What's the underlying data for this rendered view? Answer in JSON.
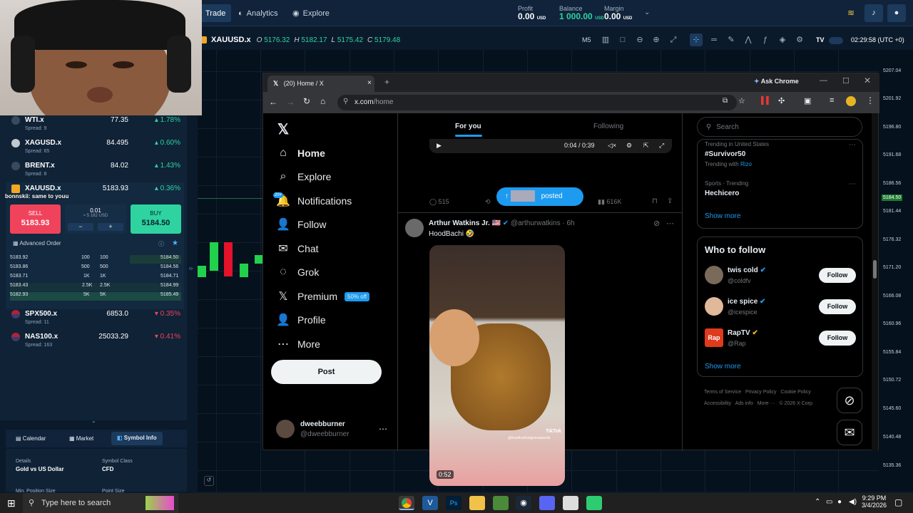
{
  "header": {
    "nav": [
      {
        "label": "Trade"
      },
      {
        "label": "Analytics"
      },
      {
        "label": "Explore"
      }
    ],
    "profit": {
      "label": "Profit",
      "value": "0.00",
      "unit": "USD"
    },
    "balance": {
      "label": "Balance",
      "value": "1 000.00",
      "unit": "USD"
    },
    "margin": {
      "label": "Margin",
      "value": "0.00",
      "unit": "USD"
    }
  },
  "symbar": {
    "symbol": "XAUUSD.x",
    "o": "O",
    "o_val": "5176.32",
    "h": "H",
    "h_val": "5182.17",
    "l": "L",
    "l_val": "5175.42",
    "c": "C",
    "c_val": "5179.48",
    "timeframe": "M5",
    "clock": "02:29:58 (UTC +0)"
  },
  "watchlist": [
    {
      "name": "WTI.x",
      "spread": "Spread: 9",
      "price": "77.35",
      "change": "1.78%",
      "dir": "up"
    },
    {
      "name": "XAGUSD.x",
      "spread": "Spread: 65",
      "price": "84.495",
      "change": "0.60%",
      "dir": "up"
    },
    {
      "name": "BRENT.x",
      "spread": "Spread: 8",
      "price": "84.02",
      "change": "1.43%",
      "dir": "up"
    },
    {
      "name": "XAUUSD.x",
      "spread": "",
      "price": "5183.93",
      "change": "0.36%",
      "dir": "up"
    },
    {
      "name": "SPX500.x",
      "spread": "Spread: 11",
      "price": "6853.0",
      "change": "0.35%",
      "dir": "down"
    },
    {
      "name": "NAS100.x",
      "spread": "Spread: 163",
      "price": "25033.29",
      "change": "0.41%",
      "dir": "down"
    }
  ],
  "chat_overlay": "bonnskii: same to youu",
  "order": {
    "sell_label": "SELL",
    "sell_price": "5183.93",
    "buy_label": "BUY",
    "buy_price": "5184.50",
    "qty": "0.01",
    "qty_note": "≈ 5 182 USD",
    "minus": "−",
    "plus": "+",
    "advanced": "Advanced Order"
  },
  "orderbook": [
    {
      "bid": "5183.92",
      "bsize": "100",
      "asize": "100",
      "ask": "5184.50"
    },
    {
      "bid": "5183.86",
      "bsize": "500",
      "asize": "500",
      "ask": "5184.56"
    },
    {
      "bid": "5183.71",
      "bsize": "1K",
      "asize": "1K",
      "ask": "5184.71"
    },
    {
      "bid": "5183.43",
      "bsize": "2.5K",
      "asize": "2.5K",
      "ask": "5184.99"
    },
    {
      "bid": "5182.93",
      "bsize": "5K",
      "asize": "5K",
      "ask": "5185.49"
    }
  ],
  "bottom_tabs": [
    {
      "label": "Calendar"
    },
    {
      "label": "Market"
    },
    {
      "label": "Symbol Info"
    }
  ],
  "symbol_info": {
    "details_label": "Details",
    "details_value": "Gold vs US Dollar",
    "class_label": "Symbol Class",
    "class_value": "CFD",
    "min_label": "Min. Position Size",
    "point_label": "Point Size"
  },
  "price_axis": [
    "5207.04",
    "5201.92",
    "5196.80",
    "5191.68",
    "5186.56",
    "5184.50",
    "5181.44",
    "5176.32",
    "5171.20",
    "5166.08",
    "5160.96",
    "5155.84",
    "5150.72",
    "5145.60",
    "5140.48",
    "5135.36"
  ],
  "chrome": {
    "tab_title": "(20) Home / X",
    "ask": "Ask Chrome",
    "url_host": "x.com",
    "url_path": "/home"
  },
  "x": {
    "nav": [
      {
        "label": "Home",
        "icon": "⌂"
      },
      {
        "label": "Explore",
        "icon": "⌕"
      },
      {
        "label": "Notifications",
        "icon": "🔔",
        "badge": "20+"
      },
      {
        "label": "Follow",
        "icon": "👤"
      },
      {
        "label": "Chat",
        "icon": "✉"
      },
      {
        "label": "Grok",
        "icon": "◌"
      },
      {
        "label": "Premium",
        "icon": "𝕏",
        "badge": "50% off"
      },
      {
        "label": "Profile",
        "icon": "👤"
      },
      {
        "label": "More",
        "icon": "⋯"
      }
    ],
    "post_button": "Post",
    "account": {
      "name": "dweebburner",
      "handle": "@dweebburner"
    },
    "tabs": {
      "for_you": "For you",
      "following": "Following"
    },
    "video_time": "0:04 / 0:39",
    "stats": {
      "replies": "515",
      "views": "616K",
      "pill": "posted"
    },
    "tweet": {
      "author": "Arthur Watkins Jr.",
      "handle": "@arthurwatkins",
      "time": "6h",
      "text": "HoodBachi",
      "duration": "0:52",
      "tiktok": "TikTok",
      "tiktok_user": "@itsarthurthatgivesawords"
    },
    "search_placeholder": "Search",
    "trends": [
      {
        "meta": "Trending in United States",
        "title": "#Survivor50",
        "extra": "Trending with",
        "extra_link": "Rizo"
      },
      {
        "meta": "Sports · Trending",
        "title": "Hechicero"
      }
    ],
    "show_more": "Show more",
    "who_to_follow": "Who to follow",
    "suggestions": [
      {
        "name": "twis cold",
        "handle": "@coldfv",
        "btn": "Follow"
      },
      {
        "name": "ice spice",
        "handle": "@icespice",
        "btn": "Follow"
      },
      {
        "name": "RapTV",
        "handle": "@Rap",
        "btn": "Follow"
      }
    ],
    "footer": [
      "Terms of Service",
      "Privacy Policy",
      "Cookie Policy",
      "Accessibility",
      "Ads info",
      "More ···",
      "© 2026 X Corp."
    ]
  },
  "taskbar": {
    "search": "Type here to search",
    "time": "9:29 PM",
    "date": "3/4/2026"
  }
}
